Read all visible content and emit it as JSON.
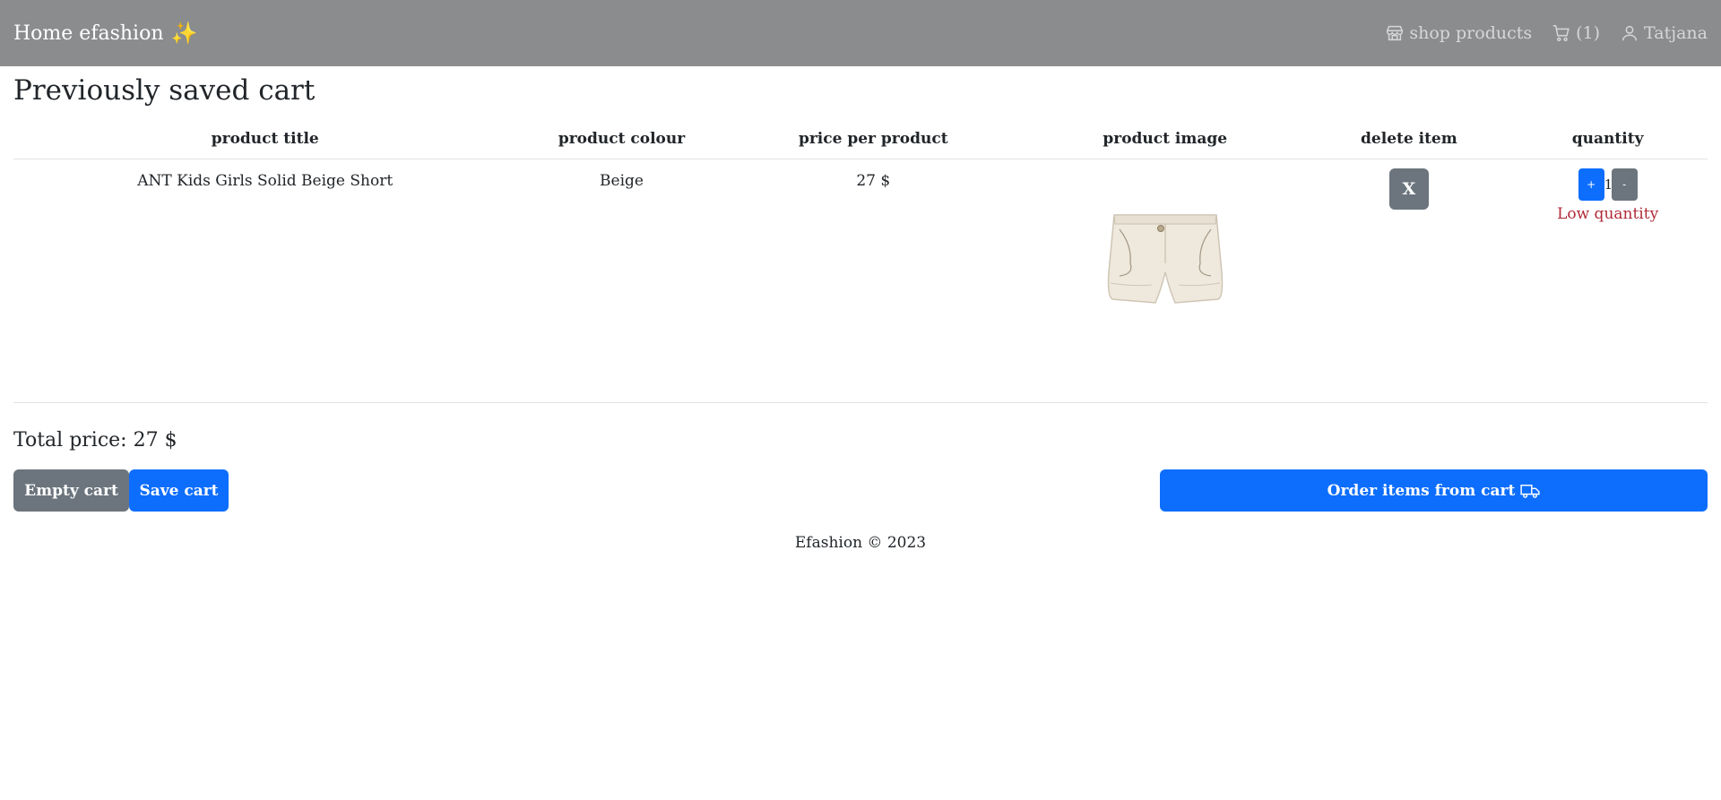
{
  "navbar": {
    "brand": "Home efashion",
    "brand_emoji": "✨",
    "shop_label": "shop products",
    "cart_count": "(1)",
    "user_name": "Tatjana"
  },
  "page_title": "Previously saved cart",
  "table": {
    "headers": [
      "product title",
      "product colour",
      "price per product",
      "product image",
      "delete item",
      "quantity"
    ],
    "rows": [
      {
        "title": "ANT Kids Girls Solid Beige Short",
        "colour": "Beige",
        "price": "27 $",
        "delete_label": "X",
        "qty_plus": "+",
        "qty_value": "1",
        "qty_minus": "-",
        "stock_warning": "Low quantity"
      }
    ]
  },
  "total_price": "Total price: 27 $",
  "buttons": {
    "empty_cart": "Empty cart",
    "save_cart": "Save cart",
    "order": "Order items from cart"
  },
  "footer": "Efashion © 2023",
  "colors": {
    "navbar_bg": "#8b8c8e",
    "primary": "#0d6efd",
    "secondary": "#6c757d",
    "danger_text": "#b02a37"
  }
}
